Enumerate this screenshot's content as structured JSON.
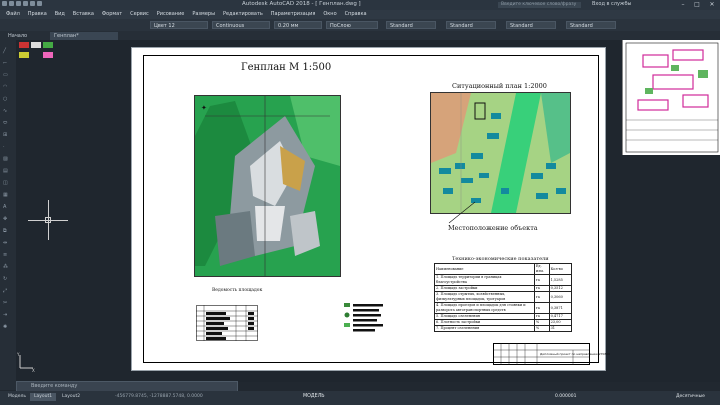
{
  "titlebar": {
    "title": "Autodesk AutoCAD 2018 - [ Генплан.dwg ]",
    "search_placeholder": "Введите ключевое слово/фразу",
    "login": "Вход в службы"
  },
  "menubar": [
    "Файл",
    "Правка",
    "Вид",
    "Вставка",
    "Формат",
    "Сервис",
    "Рисование",
    "Размеры",
    "Редактировать",
    "Параметризация",
    "Окно",
    "Справка"
  ],
  "propbar": {
    "color": "Цвет 12",
    "linetype": "Continuous",
    "lineweight": "0.20 мм",
    "plotstyle": "ПоСлою",
    "textstyle": "Standard",
    "dimstyle": "Standard",
    "tablestyle": "Standard",
    "mleaderstyle": "Standard"
  },
  "tabs": {
    "start": "Начало",
    "active": "Генплан*"
  },
  "drawing": {
    "genplan_title": "Генплан М 1:500",
    "situ_title": "Ситуационный план 1:2000",
    "location": "Местоположение объекта",
    "vedomost": "Ведомость площадок",
    "tep_title": "Технико-экономические показатели",
    "tep_headers": [
      "Наименование",
      "Ед. изм.",
      "Кол-во"
    ],
    "tep_rows": [
      [
        "1. Площадь территории в границах благоустройства",
        "га",
        "1,5285"
      ],
      [
        "2. Площадь застройки",
        "га",
        "0,3512"
      ],
      [
        "3. Площадь отрытых, хозяйственных, физкультурных площадок, тротуаров",
        "га",
        "0,3060"
      ],
      [
        "4. Площадь проездов и площадок для стоянки и разворота автотранспортных средств",
        "га",
        "0,3871"
      ],
      [
        "5. Площадь озеленения",
        "га",
        "0,4717"
      ],
      [
        "6. Плотность застройки",
        "%",
        "23,00"
      ],
      [
        "7. Процент озеленения",
        "%",
        "31"
      ]
    ],
    "stamp_text": "Дипломный проект по направлению 270800"
  },
  "cmdline": {
    "placeholder": "Введите команду"
  },
  "status": {
    "model_tab": "Модель",
    "layout1": "Layout1",
    "layout2": "Layout2",
    "coords": "-456779.8745, -1278887.5748, 0.0000",
    "model": "МОДЕЛЬ",
    "scale": "0.000001",
    "units": "Десятичные"
  }
}
